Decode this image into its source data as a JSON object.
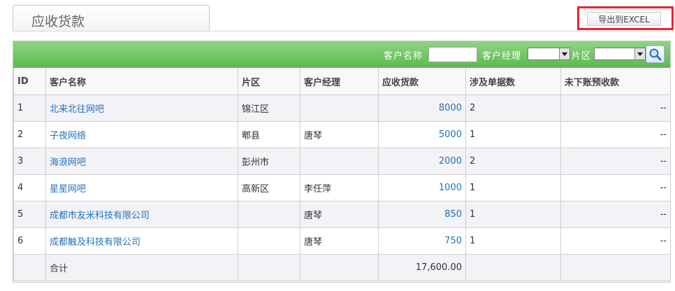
{
  "tab": {
    "title": "应收货款"
  },
  "export": {
    "label": "导出到EXCEL"
  },
  "filters": {
    "customer_name_label": "客户名称",
    "customer_name_value": "",
    "manager_label": "客户经理",
    "manager_value": "",
    "area_label": "片区",
    "area_value": ""
  },
  "table": {
    "columns": [
      "ID",
      "客户名称",
      "片区",
      "客户经理",
      "应收货款",
      "涉及单据数",
      "未下账预收款"
    ],
    "rows": [
      {
        "id": "1",
        "name": "北来北往网吧",
        "area": "锦江区",
        "manager": "",
        "amount": "8000",
        "docs": "2",
        "prepaid": "--"
      },
      {
        "id": "2",
        "name": "子夜网络",
        "area": "郫县",
        "manager": "唐琴",
        "amount": "5000",
        "docs": "1",
        "prepaid": "--"
      },
      {
        "id": "3",
        "name": "海浪网吧",
        "area": "彭州市",
        "manager": "",
        "amount": "2000",
        "docs": "2",
        "prepaid": "--"
      },
      {
        "id": "4",
        "name": "星星网吧",
        "area": "高新区",
        "manager": "李任萍",
        "amount": "1000",
        "docs": "1",
        "prepaid": "--"
      },
      {
        "id": "5",
        "name": "成都市友米科技有限公司",
        "area": "",
        "manager": "唐琴",
        "amount": "850",
        "docs": "1",
        "prepaid": "--"
      },
      {
        "id": "6",
        "name": "成都触及科技有限公司",
        "area": "",
        "manager": "唐琴",
        "amount": "750",
        "docs": "1",
        "prepaid": "--"
      }
    ],
    "total_label": "合计",
    "total_amount": "17,600.00"
  },
  "colors": {
    "header_green": "#5cb84f",
    "link_blue": "#1e73be",
    "highlight_red": "#e8262d"
  }
}
